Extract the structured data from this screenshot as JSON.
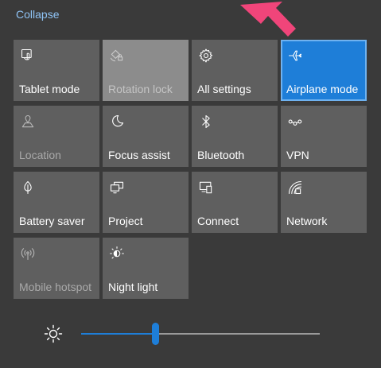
{
  "header": {
    "collapse_label": "Collapse"
  },
  "tiles": [
    {
      "key": "tablet-mode",
      "label": "Tablet mode",
      "icon": "tablet-icon",
      "state": "normal"
    },
    {
      "key": "rotation-lock",
      "label": "Rotation lock",
      "icon": "rotation-lock-icon",
      "state": "light"
    },
    {
      "key": "all-settings",
      "label": "All settings",
      "icon": "gear-icon",
      "state": "normal"
    },
    {
      "key": "airplane-mode",
      "label": "Airplane mode",
      "icon": "airplane-icon",
      "state": "active"
    },
    {
      "key": "location",
      "label": "Location",
      "icon": "location-icon",
      "state": "disabled"
    },
    {
      "key": "focus-assist",
      "label": "Focus assist",
      "icon": "moon-icon",
      "state": "normal"
    },
    {
      "key": "bluetooth",
      "label": "Bluetooth",
      "icon": "bluetooth-icon",
      "state": "normal"
    },
    {
      "key": "vpn",
      "label": "VPN",
      "icon": "vpn-icon",
      "state": "normal"
    },
    {
      "key": "battery-saver",
      "label": "Battery saver",
      "icon": "battery-saver-icon",
      "state": "normal"
    },
    {
      "key": "project",
      "label": "Project",
      "icon": "project-icon",
      "state": "normal"
    },
    {
      "key": "connect",
      "label": "Connect",
      "icon": "connect-icon",
      "state": "normal"
    },
    {
      "key": "network",
      "label": "Network",
      "icon": "network-icon",
      "state": "normal"
    },
    {
      "key": "mobile-hotspot",
      "label": "Mobile hotspot",
      "icon": "hotspot-icon",
      "state": "disabled"
    },
    {
      "key": "night-light",
      "label": "Night light",
      "icon": "night-light-icon",
      "state": "normal"
    }
  ],
  "brightness": {
    "icon": "sun-icon",
    "level_percent": 31
  },
  "colors": {
    "accent": "#1e7ed8",
    "tile": "#5f5f5f",
    "background": "#3a3a3a",
    "link": "#8fc3f5",
    "pointer": "#f0457a"
  }
}
